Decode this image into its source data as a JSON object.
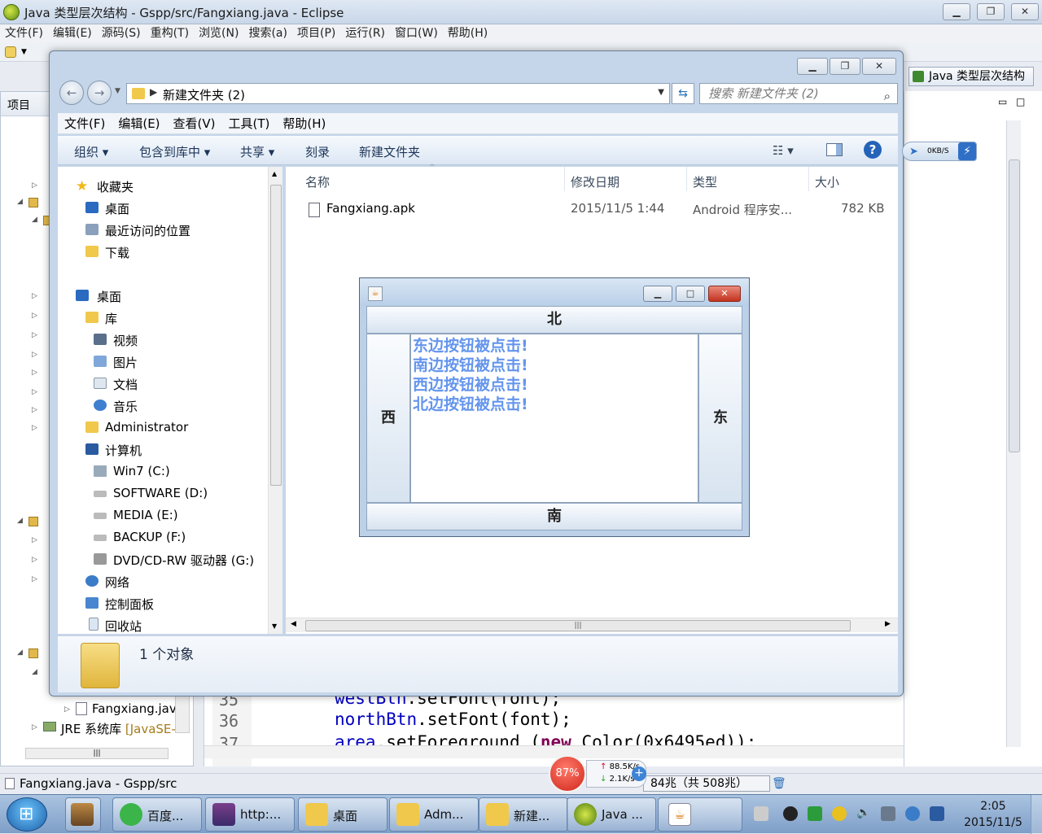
{
  "eclipse": {
    "title": "Java 类型层次结构 - Gspp/src/Fangxiang.java - Eclipse",
    "menu": [
      "文件(F)",
      "编辑(E)",
      "源码(S)",
      "重构(T)",
      "浏览(N)",
      "搜索(a)",
      "项目(P)",
      "运行(R)",
      "窗口(W)",
      "帮助(H)"
    ],
    "left_panel_tab": "项目",
    "tree_file": "Fangxiang.jav",
    "tree_jre": "JRE 系统库",
    "tree_jre_suffix": "[JavaSE-",
    "right_tab": "Java 类型层次结构",
    "code": {
      "lines": [
        {
          "no": "35",
          "var": "westBtn",
          "rest": ".setFont(font);"
        },
        {
          "no": "36",
          "var": "northBtn",
          "rest": ".setFont(font);"
        },
        {
          "no": "37",
          "var": "area",
          "rest": ".setForeground (",
          "kw": "new",
          "rest2": " Color(0x6495ed));"
        }
      ]
    },
    "status": {
      "text": "Fangxiang.java - Gspp/src",
      "memory": "84兆（共 508兆）"
    }
  },
  "explorer": {
    "path": "新建文件夹 (2)",
    "search_placeholder": "搜索 新建文件夹 (2)",
    "menu": [
      "文件(F)",
      "编辑(E)",
      "查看(V)",
      "工具(T)",
      "帮助(H)"
    ],
    "commands": [
      "组织",
      "包含到库中",
      "共享",
      "刻录",
      "新建文件夹"
    ],
    "nav": {
      "favorites": "收藏夹",
      "fav_items": [
        "桌面",
        "最近访问的位置",
        "下载"
      ],
      "desktop": "桌面",
      "library": "库",
      "library_items": [
        "视频",
        "图片",
        "文档",
        "音乐"
      ],
      "user": "Administrator",
      "computer": "计算机",
      "drives": [
        "Win7 (C:)",
        "SOFTWARE (D:)",
        "MEDIA (E:)",
        "BACKUP (F:)",
        "DVD/CD-RW 驱动器 (G:)"
      ],
      "network": "网络",
      "control_panel": "控制面板",
      "recycle": "回收站"
    },
    "columns": [
      "名称",
      "修改日期",
      "类型",
      "大小"
    ],
    "files": [
      {
        "name": "Fangxiang.apk",
        "date": "2015/11/5 1:44",
        "type": "Android 程序安...",
        "size": "782 KB"
      }
    ],
    "details": "1 个对象"
  },
  "swing": {
    "north": "北",
    "south": "南",
    "west": "西",
    "east": "东",
    "area_lines": [
      "东边按钮被点击!",
      "南边按钮被点击!",
      "西边按钮被点击!",
      "北边按钮被点击!"
    ],
    "text_color": "#6495ed"
  },
  "taskbar": {
    "tasks": [
      "百度...",
      "http:...",
      "桌面",
      "Adm...",
      "新建...",
      "Java ..."
    ],
    "time": "2:05",
    "date": "2015/11/5"
  },
  "netwidget": {
    "percent": "87%",
    "up": "88.5K/s",
    "down": "2.1K/s"
  },
  "speedpill": "0KB/S"
}
